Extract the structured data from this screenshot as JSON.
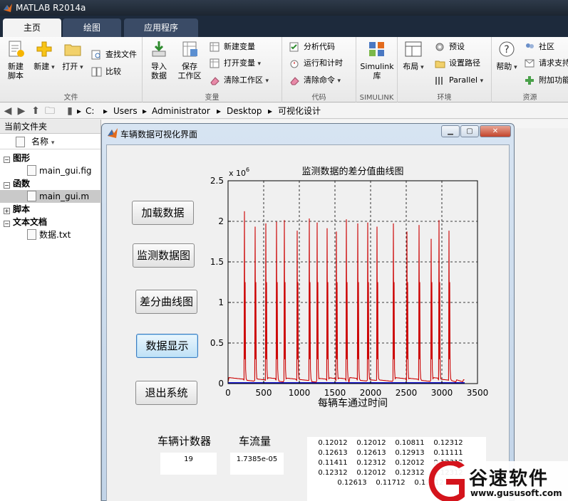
{
  "app": {
    "title": "MATLAB R2014a"
  },
  "tabs": [
    {
      "label": "主页"
    },
    {
      "label": "绘图"
    },
    {
      "label": "应用程序"
    }
  ],
  "ribbon": {
    "file_group": {
      "label": "文件",
      "new_script": "新建\n脚本",
      "new": "新建",
      "open": "打开",
      "find_files": "查找文件",
      "compare": "比较"
    },
    "variable_group": {
      "label": "变量",
      "import_data": "导入\n数据",
      "save_workspace": "保存\n工作区",
      "new_variable": "新建变量",
      "open_variable": "打开变量",
      "clear_workspace": "清除工作区"
    },
    "code_group": {
      "label": "代码",
      "analyze_code": "分析代码",
      "run_and_time": "运行和计时",
      "clear_commands": "清除命令"
    },
    "simulink_group": {
      "label": "SIMULINK",
      "simulink_library": "Simulink\n库"
    },
    "environment_group": {
      "label": "环境",
      "layout": "布局",
      "preferences": "预设",
      "set_path": "设置路径",
      "parallel": "Parallel"
    },
    "resources_group": {
      "label": "资源",
      "help": "帮助",
      "community": "社区",
      "request_support": "请求支持",
      "add_ons": "附加功能"
    }
  },
  "address_bar": {
    "crumbs": [
      "C:",
      "Users",
      "Administrator",
      "Desktop",
      "可视化设计"
    ]
  },
  "current_folder": {
    "title": "当前文件夹",
    "column_name": "名称",
    "groups": [
      {
        "label": "图形",
        "expand": "⊟",
        "files": [
          "main_gui.fig"
        ]
      },
      {
        "label": "函数",
        "expand": "⊟",
        "files": [
          "main_gui.m"
        ]
      },
      {
        "label": "脚本",
        "expand": "⊞",
        "files": []
      },
      {
        "label": "文本文档",
        "expand": "⊟",
        "files": [
          "数据.txt"
        ]
      }
    ]
  },
  "gui_window": {
    "title": "车辆数据可视化界面",
    "buttons": {
      "load_data": "加载数据",
      "monitor_plot": "监测数据图",
      "diff_curve": "差分曲线图",
      "data_display": "数据显示",
      "exit_system": "退出系统"
    },
    "labels": {
      "vehicle_counter": "车辆计数器",
      "traffic_flow": "车流量"
    },
    "values": {
      "vehicle_count": "19",
      "traffic_flow": "1.7385e-05"
    },
    "data_table": [
      [
        "0.12012",
        "0.12012",
        "0.10811",
        "0.12312"
      ],
      [
        "0.12613",
        "0.12613",
        "0.12913",
        "0.11111"
      ],
      [
        "0.11411",
        "0.12312",
        "0.12012",
        "0.12312"
      ],
      [
        "0.12312",
        "0.12012",
        "0.12312",
        "0.12312"
      ],
      [
        "0.12613",
        "0.11712",
        "0.12012"
      ]
    ]
  },
  "chart_data": {
    "type": "line",
    "title": "监测数据的差分值曲线图",
    "xlabel": "每辆车通过时间",
    "ylabel": "",
    "y_exponent_label": "x 10",
    "y_exponent": "6",
    "xlim": [
      0,
      3500
    ],
    "ylim": [
      0,
      2.5
    ],
    "xticks": [
      "0",
      "500",
      "1000",
      "1500",
      "2000",
      "2500",
      "3000",
      "3500"
    ],
    "yticks": [
      "0",
      "0.5",
      "1",
      "1.5",
      "2",
      "2.5"
    ],
    "grid": true,
    "series_color": "#cc0000",
    "baseline_color": "#0000cc",
    "peaks": [
      {
        "x": 230,
        "y": 2.12
      },
      {
        "x": 380,
        "y": 1.93
      },
      {
        "x": 530,
        "y": 1.97
      },
      {
        "x": 680,
        "y": 1.99
      },
      {
        "x": 790,
        "y": 2.01
      },
      {
        "x": 970,
        "y": 1.88
      },
      {
        "x": 1140,
        "y": 2.03
      },
      {
        "x": 1250,
        "y": 1.98
      },
      {
        "x": 1390,
        "y": 1.91
      },
      {
        "x": 1520,
        "y": 1.87
      },
      {
        "x": 1660,
        "y": 2.02
      },
      {
        "x": 1820,
        "y": 1.97
      },
      {
        "x": 1960,
        "y": 1.98
      },
      {
        "x": 2090,
        "y": 1.93
      },
      {
        "x": 2320,
        "y": 1.97
      },
      {
        "x": 2510,
        "y": 1.87
      },
      {
        "x": 2680,
        "y": 1.95
      },
      {
        "x": 2850,
        "y": 1.78
      },
      {
        "x": 2960,
        "y": 2.01
      },
      {
        "x": 3100,
        "y": 1.88
      }
    ]
  },
  "watermark": {
    "name": "谷速软件",
    "url": "www.gususoft.com"
  }
}
